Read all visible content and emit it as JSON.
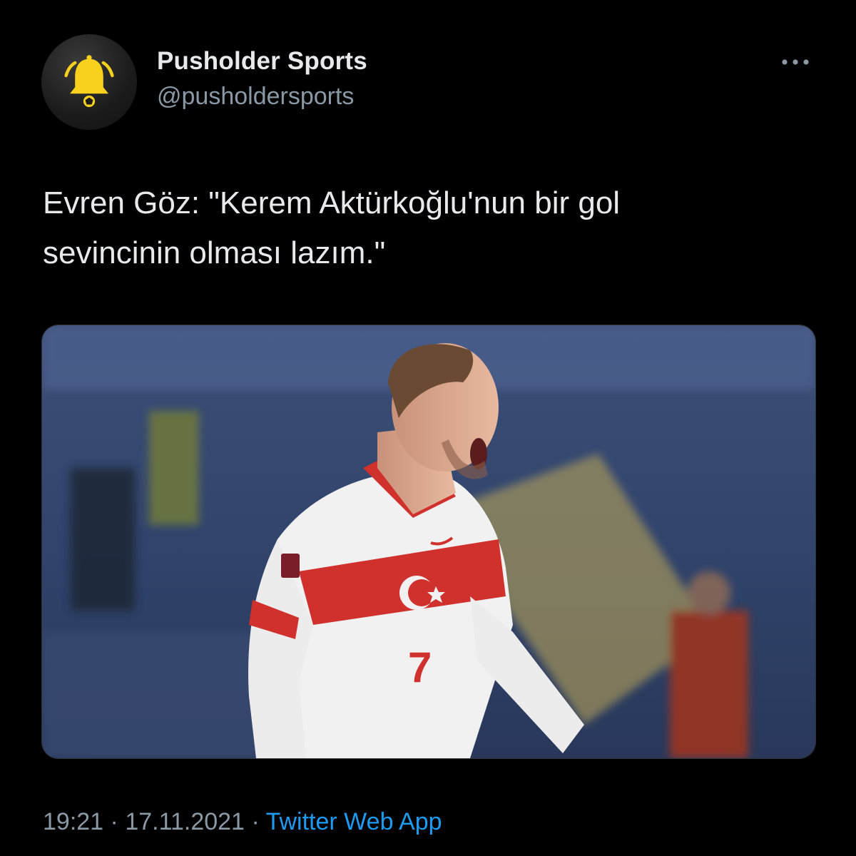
{
  "tweet": {
    "author": {
      "display_name": "Pusholder Sports",
      "handle": "@pusholdersports",
      "avatar_icon": "bell-icon",
      "avatar_color": "#f7d11e"
    },
    "more_icon": "more-horizontal-icon",
    "text": "Evren Göz: \"Kerem Aktürkoğlu'nun bir gol\nsevincinin olması lazım.\"",
    "media": {
      "shirt_number": "7"
    },
    "time": "19:21",
    "separator": "·",
    "date": "17.11.2021",
    "source": "Twitter Web App",
    "colors": {
      "background": "#000000",
      "text": "#e7e9ea",
      "secondary": "#8b98a5",
      "link": "#1d9bf0"
    }
  }
}
